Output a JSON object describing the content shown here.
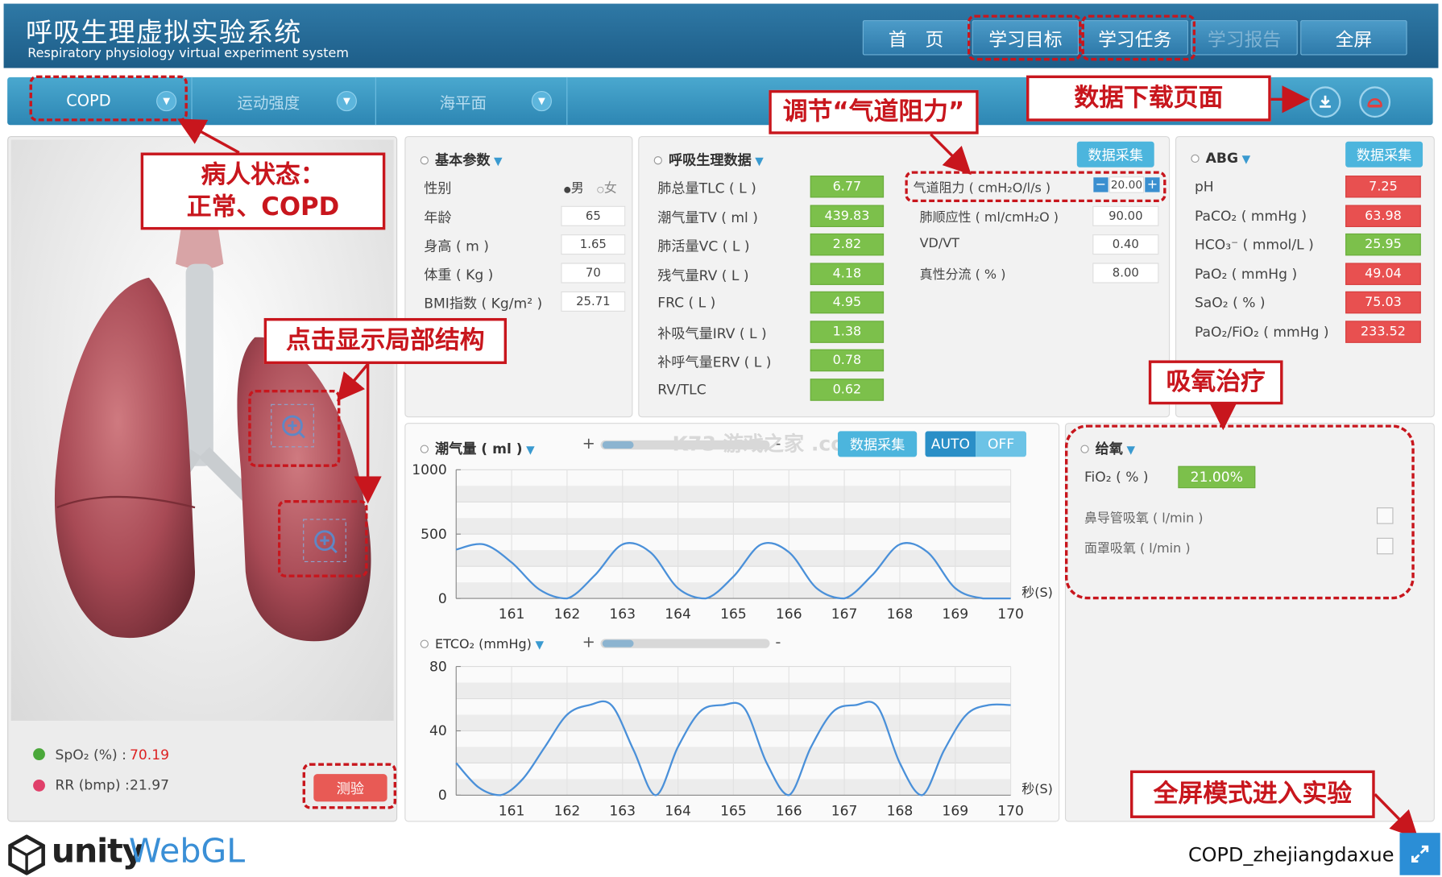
{
  "header": {
    "title": "呼吸生理虚拟实验系统",
    "subtitle": "Respiratory physiology virtual experiment system",
    "nav": [
      "首　页",
      "学习目标",
      "学习任务",
      "学习报告",
      "全屏"
    ]
  },
  "selectors": {
    "patient": "COPD",
    "exercise": "运动强度",
    "altitude": "海平面"
  },
  "basic": {
    "title": "基本参数",
    "sex_label": "性别",
    "male": "男",
    "female": "女",
    "rows": [
      {
        "label": "年龄",
        "value": "65"
      },
      {
        "label": "身高 ( m )",
        "value": "1.65"
      },
      {
        "label": "体重 ( Kg )",
        "value": "70"
      },
      {
        "label": "BMI指数 ( Kg/m² )",
        "value": "25.71"
      }
    ]
  },
  "resp": {
    "title": "呼吸生理数据",
    "collect": "数据采集",
    "rows": [
      {
        "label": "肺总量TLC ( L )",
        "value": "6.77"
      },
      {
        "label": "潮气量TV ( ml )",
        "value": "439.83"
      },
      {
        "label": "肺活量VC ( L )",
        "value": "2.82"
      },
      {
        "label": "残气量RV ( L )",
        "value": "4.18"
      },
      {
        "label": "FRC ( L )",
        "value": "4.95"
      },
      {
        "label": "补吸气量IRV ( L )",
        "value": "1.38"
      },
      {
        "label": "补呼气量ERV ( L )",
        "value": "0.78"
      },
      {
        "label": "RV/TLC",
        "value": "0.62"
      }
    ],
    "right": [
      {
        "label": "气道阻力 ( cmH₂O/l/s )",
        "value": "20.00"
      },
      {
        "label": "肺顺应性 ( ml/cmH₂O )",
        "value": "90.00"
      },
      {
        "label": "VD/VT",
        "value": "0.40"
      },
      {
        "label": "真性分流 ( % )",
        "value": "8.00"
      }
    ]
  },
  "abg": {
    "title": "ABG",
    "collect": "数据采集",
    "rows": [
      {
        "label": "pH",
        "value": "7.25",
        "status": "red"
      },
      {
        "label": "PaCO₂ ( mmHg )",
        "value": "63.98",
        "status": "red"
      },
      {
        "label": "HCO₃⁻ ( mmol/L )",
        "value": "25.95",
        "status": "green"
      },
      {
        "label": "PaO₂ ( mmHg )",
        "value": "49.04",
        "status": "red"
      },
      {
        "label": "SaO₂ ( % )",
        "value": "75.03",
        "status": "red"
      },
      {
        "label": "PaO₂/FiO₂ ( mmHg )",
        "value": "233.52",
        "status": "red"
      }
    ]
  },
  "oxygen": {
    "title": "给氧",
    "fio2_label": "FiO₂ ( % )",
    "fio2_value": "21.00%",
    "nasal": "鼻导管吸氧 ( l/min )",
    "mask": "面罩吸氧 ( l/min )"
  },
  "charts": {
    "collect": "数据采集",
    "auto": "AUTO",
    "off": "OFF",
    "plus": "+",
    "minus": "-",
    "watermark": "K73 游戏之家 .com"
  },
  "vitals": {
    "spo2_label": "SpO₂ (%) :",
    "spo2_value": "70.19",
    "rr_label": "RR (bmp) :",
    "rr_value": "21.97",
    "test": "测验"
  },
  "footer": {
    "brand": "unity",
    "webgl": "WebGL",
    "project": "COPD_zhejiangdaxue"
  },
  "annotations": {
    "patient": "病人状态：\n正常、COPD",
    "structure": "点击显示局部结构",
    "airway": "调节“气道阻力”",
    "download": "数据下载页面",
    "oxygen": "吸氧治疗",
    "fullscreen": "全屏模式进入实验"
  },
  "chart_data": [
    {
      "type": "line",
      "title": "潮气量 ( ml )",
      "xlabel": "秒(S)",
      "ylabel": "",
      "x": [
        160.0,
        160.5,
        161.0,
        161.5,
        162.0,
        162.5,
        163.0,
        163.5,
        164.0,
        164.5,
        165.0,
        165.5,
        166.0,
        166.5,
        167.0,
        167.5,
        168.0,
        168.5,
        169.0,
        169.5,
        170.0
      ],
      "y": [
        380,
        420,
        280,
        70,
        0,
        180,
        420,
        360,
        80,
        0,
        170,
        420,
        360,
        80,
        0,
        180,
        420,
        360,
        80,
        0,
        0
      ],
      "xticks": [
        "161",
        "162",
        "163",
        "164",
        "165",
        "166",
        "167",
        "168",
        "169",
        "170"
      ],
      "yticks": [
        "0",
        "500",
        "1000"
      ],
      "ylim": [
        0,
        1000
      ],
      "xlim": [
        160,
        170
      ],
      "color": "#4a90d9"
    },
    {
      "type": "line",
      "title": "ETCO₂ (mmHg)",
      "xlabel": "秒(S)",
      "ylabel": "",
      "x": [
        160.0,
        160.4,
        160.8,
        161.2,
        161.6,
        162.0,
        162.4,
        162.8,
        163.2,
        163.6,
        164.0,
        164.4,
        164.8,
        165.2,
        165.6,
        166.0,
        166.4,
        166.8,
        167.2,
        167.6,
        168.0,
        168.4,
        168.8,
        169.2,
        169.6,
        170.0
      ],
      "y": [
        20,
        5,
        0,
        10,
        30,
        50,
        56,
        56,
        28,
        0,
        30,
        52,
        56,
        54,
        20,
        0,
        30,
        52,
        56,
        55,
        20,
        0,
        28,
        50,
        56,
        56
      ],
      "xticks": [
        "161",
        "162",
        "163",
        "164",
        "165",
        "166",
        "167",
        "168",
        "169",
        "170"
      ],
      "yticks": [
        "0",
        "40",
        "80"
      ],
      "ylim": [
        0,
        80
      ],
      "xlim": [
        160,
        170
      ],
      "color": "#4a90d9"
    }
  ],
  "colors": {
    "header": "#1d5d88",
    "accent": "#4cb5dd",
    "alert": "#c8161d",
    "green": "#7cc04b",
    "red": "#e85050"
  }
}
